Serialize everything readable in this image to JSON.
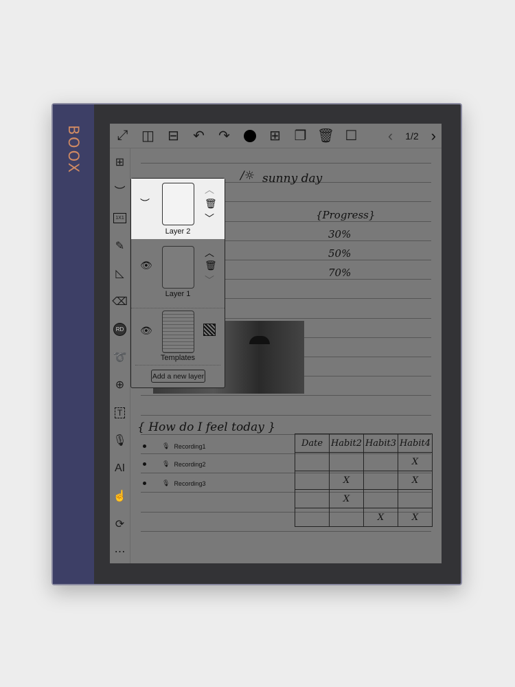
{
  "brand": "BOOX",
  "toolbar": {
    "icons": [
      "expand-icon",
      "split-vertical-icon",
      "split-horizontal-icon",
      "undo-icon",
      "redo-icon",
      "pen-color-icon",
      "add-page-icon",
      "copy-page-icon",
      "trash-icon",
      "checkbox-icon"
    ],
    "page": "1/2"
  },
  "sidebar": {
    "icons": [
      "grid-icon",
      "layer-eye-closed-icon",
      "ratio-1x1-icon",
      "pen-icon",
      "shape-icon",
      "eraser-icon",
      "rd-icon",
      "lasso-icon",
      "zoom-in-icon",
      "text-box-icon",
      "microphone-icon",
      "ai-icon",
      "touch-icon",
      "refresh-icon",
      "more-icon"
    ],
    "ratio_label": "1X1",
    "rd_label": "RD",
    "ai_label": "AI"
  },
  "note": {
    "heading": "sunny day",
    "progress_title": "{Progress}",
    "progress": [
      "30%",
      "50%",
      "70%"
    ],
    "feel_title": "{ How do I feel today }",
    "recordings": [
      "Recording1",
      "Recording2",
      "Recording3"
    ],
    "habit_headers": [
      "Date",
      "Habit2",
      "Habit3",
      "Habit4"
    ],
    "habit_rows": [
      [
        "",
        "",
        "",
        "X"
      ],
      [
        "",
        "X",
        "",
        "X"
      ],
      [
        "",
        "X",
        "",
        ""
      ],
      [
        "",
        "",
        "X",
        "X"
      ]
    ]
  },
  "layers_panel": {
    "layers": [
      {
        "name": "Layer 2",
        "visible": false,
        "selected": true
      },
      {
        "name": "Layer 1",
        "visible": true,
        "selected": false
      },
      {
        "name": "Templates",
        "visible": true,
        "selected": false
      }
    ],
    "add_label": "Add a new layer"
  }
}
